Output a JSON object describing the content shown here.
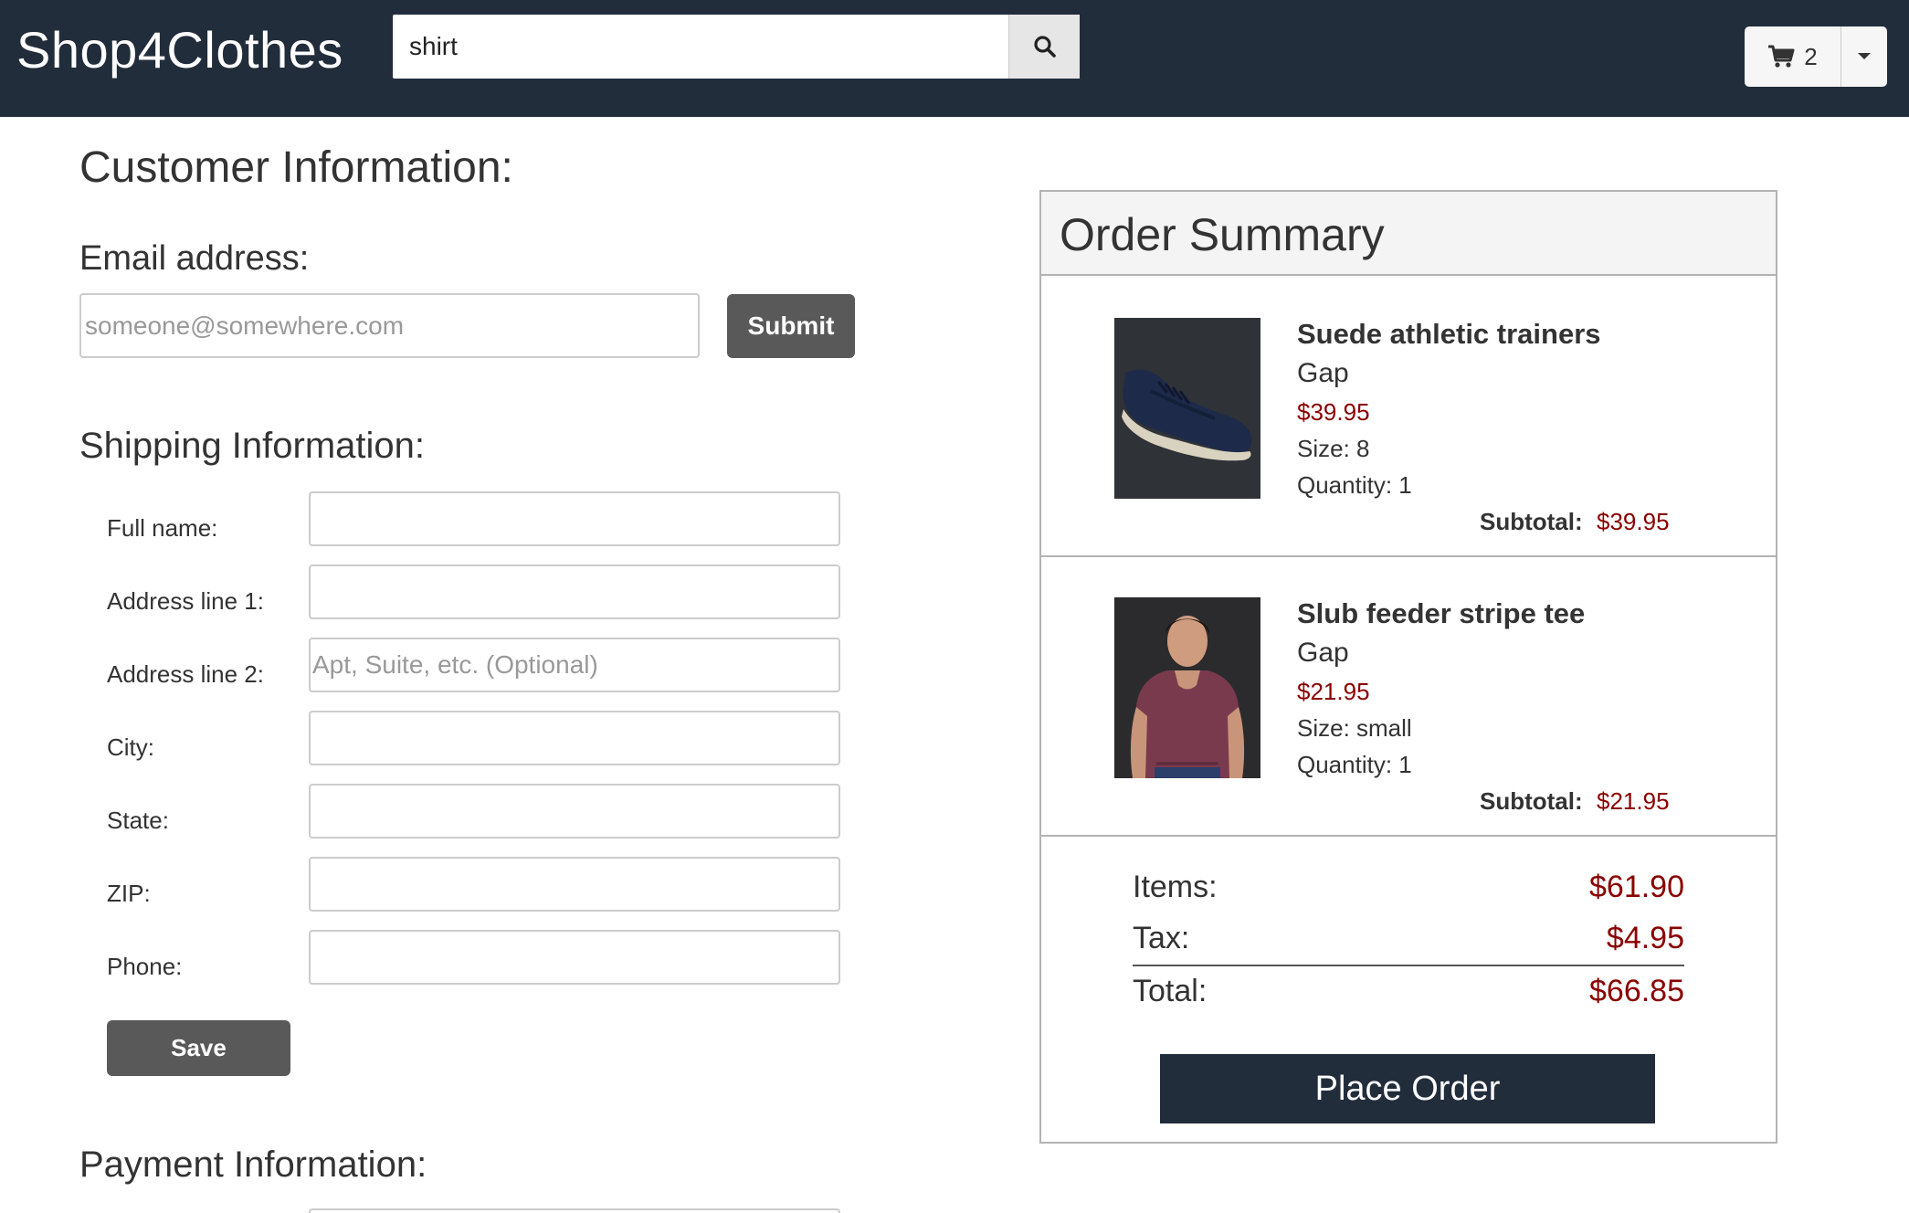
{
  "header": {
    "brand": "Shop4Clothes",
    "search": {
      "value": "shirt"
    },
    "cart": {
      "count": "2"
    }
  },
  "customer": {
    "title": "Customer Information:",
    "email": {
      "label": "Email address:",
      "placeholder": "someone@somewhere.com",
      "submit_label": "Submit"
    }
  },
  "shipping": {
    "title": "Shipping Information:",
    "fields": [
      {
        "label": "Full name:",
        "placeholder": ""
      },
      {
        "label": "Address line 1:",
        "placeholder": ""
      },
      {
        "label": "Address line 2:",
        "placeholder": "Apt, Suite, etc. (Optional)"
      },
      {
        "label": "City:",
        "placeholder": ""
      },
      {
        "label": "State:",
        "placeholder": ""
      },
      {
        "label": "ZIP:",
        "placeholder": ""
      },
      {
        "label": "Phone:",
        "placeholder": ""
      }
    ],
    "save_label": "Save"
  },
  "payment": {
    "title": "Payment Information:"
  },
  "summary": {
    "title": "Order Summary",
    "items": [
      {
        "name": "Suede athletic trainers",
        "brand": "Gap",
        "price": "$39.95",
        "size": "Size: 8",
        "quantity": "Quantity: 1",
        "subtotal_label": "Subtotal:",
        "subtotal": "$39.95",
        "image_icon": "navy-suede-sneaker-image"
      },
      {
        "name": "Slub feeder stripe tee",
        "brand": "Gap",
        "price": "$21.95",
        "size": "Size: small",
        "quantity": "Quantity: 1",
        "subtotal_label": "Subtotal:",
        "subtotal": "$21.95",
        "image_icon": "man-in-maroon-tee-image"
      }
    ],
    "totals": {
      "items_label": "Items:",
      "items_value": "$61.90",
      "tax_label": "Tax:",
      "tax_value": "$4.95",
      "total_label": "Total:",
      "total_value": "$66.85"
    },
    "place_order_label": "Place Order"
  },
  "colors": {
    "navbar": "#222d3c",
    "price_red": "#8b0000",
    "button_gray": "#595959"
  }
}
